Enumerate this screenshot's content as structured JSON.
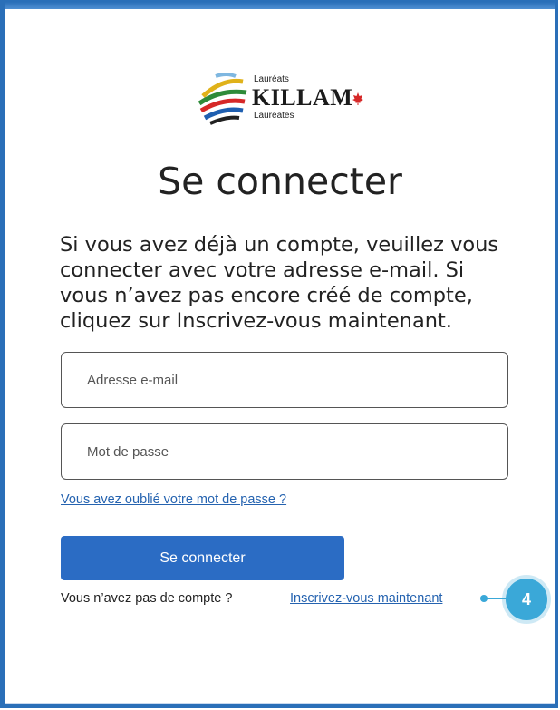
{
  "logo": {
    "top_text": "Lauréats",
    "word": "KILLAM",
    "bottom_text": "Laureates"
  },
  "title": "Se connecter",
  "intro": "Si vous avez déjà un compte, veuillez vous connecter avec votre adresse e-mail. Si vous n’avez pas encore créé de compte, cliquez sur Inscrivez-vous maintenant.",
  "form": {
    "email_placeholder": "Adresse e-mail",
    "password_placeholder": "Mot de passe",
    "forgot_link": "Vous avez oublié votre mot de passe ?",
    "submit_label": "Se connecter",
    "no_account_text": "Vous n’avez pas de compte ?",
    "signup_link": "Inscrivez-vous maintenant"
  },
  "callout": {
    "number": "4",
    "color": "#3aa8d8"
  },
  "colors": {
    "primary_button": "#2b6cc4",
    "link": "#2563b0",
    "frame": "#2a6fb8"
  }
}
